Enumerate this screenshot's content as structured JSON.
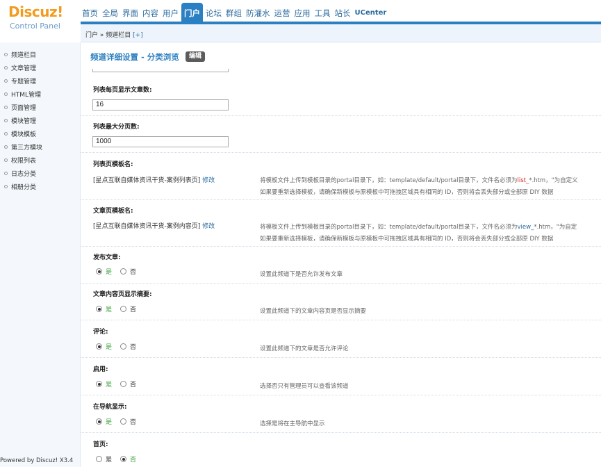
{
  "logo": {
    "brand": "Discuz!",
    "subtitle": "Control Panel"
  },
  "topnav": [
    {
      "label": "首页"
    },
    {
      "label": "全局"
    },
    {
      "label": "界面"
    },
    {
      "label": "内容"
    },
    {
      "label": "用户"
    },
    {
      "label": "门户",
      "active": true
    },
    {
      "label": "论坛"
    },
    {
      "label": "群组"
    },
    {
      "label": "防灌水"
    },
    {
      "label": "运营"
    },
    {
      "label": "应用"
    },
    {
      "label": "工具"
    },
    {
      "label": "站长"
    },
    {
      "label": "UCenter"
    }
  ],
  "breadcrumb": {
    "path": "门户 » 频道栏目",
    "plus": "[+]"
  },
  "sidebar": {
    "items": [
      "频道栏目",
      "文章管理",
      "专题管理",
      "HTML管理",
      "页面管理",
      "模块管理",
      "模块模板",
      "第三方模块",
      "权限列表",
      "日志分类",
      "相册分类"
    ],
    "powered": "Powered by Discuz! X3.4"
  },
  "main": {
    "title": "频道详细设置 - 分类浏览",
    "edit_label": "编辑",
    "per_page": {
      "label": "列表每页显示文章数:",
      "value": "16"
    },
    "max_pages": {
      "label": "列表最大分页数:",
      "value": "1000"
    },
    "list_tpl": {
      "label": "列表页模板名:",
      "value": "[星点互联自媒体资讯干货-案例列表页]",
      "modify": "修改",
      "hint1_a": "将模板文件上传到模板目录的portal目录下，如：template/default/portal目录下，文件名必须为",
      "hint1_b": "list_",
      "hint1_c": "*.htm，\"为自定义",
      "hint2": "如果要重新选择模板，请确保新模板与原模板中可拖拽区域具有相同的 ID，否则将会丢失部分或全部原 DIY 数据"
    },
    "view_tpl": {
      "label": "文章页模板名:",
      "value": "[星点互联自媒体资讯干货-案例内容页]",
      "modify": "修改",
      "hint1_a": "将模板文件上传到模板目录的portal目录下，如：template/default/portal目录下，文件名必须为",
      "hint1_b": "view_",
      "hint1_c": "*.htm，\"为自定",
      "hint2": "如果要重新选择模板，请确保新模板与原模板中可拖拽区域具有相同的 ID，否则将会丢失部分或全部原 DIY 数据"
    },
    "yes": "是",
    "no": "否",
    "publish": {
      "label": "发布文章:",
      "hint": "设置此频道下是否允许发布文章",
      "selected": "yes"
    },
    "summary": {
      "label": "文章内容页显示摘要:",
      "hint": "设置此频道下的文章内容页是否显示摘要",
      "selected": "yes"
    },
    "comment": {
      "label": "评论:",
      "hint": "设置此频道下的文章是否允许评论",
      "selected": "yes"
    },
    "enable": {
      "label": "启用:",
      "hint": "选择否只有管理员可以查看该频道",
      "selected": "yes"
    },
    "nav_show": {
      "label": "在导航显示:",
      "hint": "选择是将在主导航中显示",
      "selected": "yes"
    },
    "homepage": {
      "label": "首页:",
      "selected": "no"
    }
  }
}
